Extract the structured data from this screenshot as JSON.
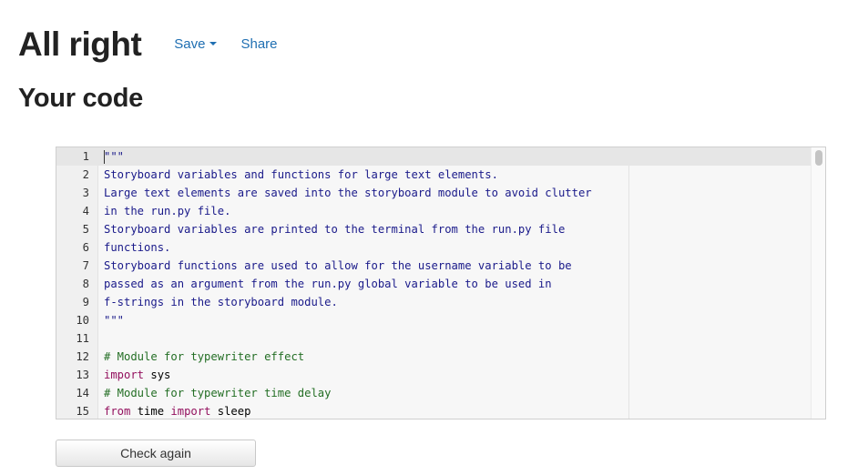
{
  "header": {
    "title": "All right",
    "save_label": "Save",
    "share_label": "Share"
  },
  "section": {
    "title": "Your code"
  },
  "editor": {
    "lines": [
      {
        "num": "1",
        "tokens": [
          {
            "t": "\"\"\"",
            "c": "str"
          }
        ]
      },
      {
        "num": "2",
        "tokens": [
          {
            "t": "Storyboard variables and functions for large text elements.",
            "c": "str"
          }
        ]
      },
      {
        "num": "3",
        "tokens": [
          {
            "t": "Large text elements are saved into the storyboard module to avoid clutter",
            "c": "str"
          }
        ]
      },
      {
        "num": "4",
        "tokens": [
          {
            "t": "in the run.py file.",
            "c": "str"
          }
        ]
      },
      {
        "num": "5",
        "tokens": [
          {
            "t": "Storyboard variables are printed to the terminal from the run.py file",
            "c": "str"
          }
        ]
      },
      {
        "num": "6",
        "tokens": [
          {
            "t": "functions.",
            "c": "str"
          }
        ]
      },
      {
        "num": "7",
        "tokens": [
          {
            "t": "Storyboard functions are used to allow for the username variable to be",
            "c": "str"
          }
        ]
      },
      {
        "num": "8",
        "tokens": [
          {
            "t": "passed as an argument from the run.py global variable to be used in",
            "c": "str"
          }
        ]
      },
      {
        "num": "9",
        "tokens": [
          {
            "t": "f-strings in the storyboard module.",
            "c": "str"
          }
        ]
      },
      {
        "num": "10",
        "tokens": [
          {
            "t": "\"\"\"",
            "c": "str"
          }
        ]
      },
      {
        "num": "11",
        "tokens": []
      },
      {
        "num": "12",
        "tokens": [
          {
            "t": "# Module for typewriter effect",
            "c": "comment"
          }
        ]
      },
      {
        "num": "13",
        "tokens": [
          {
            "t": "import",
            "c": "keyword"
          },
          {
            "t": " sys",
            "c": "plain"
          }
        ]
      },
      {
        "num": "14",
        "tokens": [
          {
            "t": "# Module for typewriter time delay",
            "c": "comment"
          }
        ]
      },
      {
        "num": "15",
        "tokens": [
          {
            "t": "from",
            "c": "keyword"
          },
          {
            "t": " time ",
            "c": "plain"
          },
          {
            "t": "import",
            "c": "keyword"
          },
          {
            "t": " sleep",
            "c": "plain"
          }
        ]
      }
    ]
  },
  "actions": {
    "check_again_label": "Check again"
  },
  "colors": {
    "link": "#1f6fb2",
    "string": "#1a1a8a",
    "comment": "#236e24",
    "keyword": "#93105e"
  },
  "icons": {
    "save_dropdown": "caret-down-icon"
  }
}
